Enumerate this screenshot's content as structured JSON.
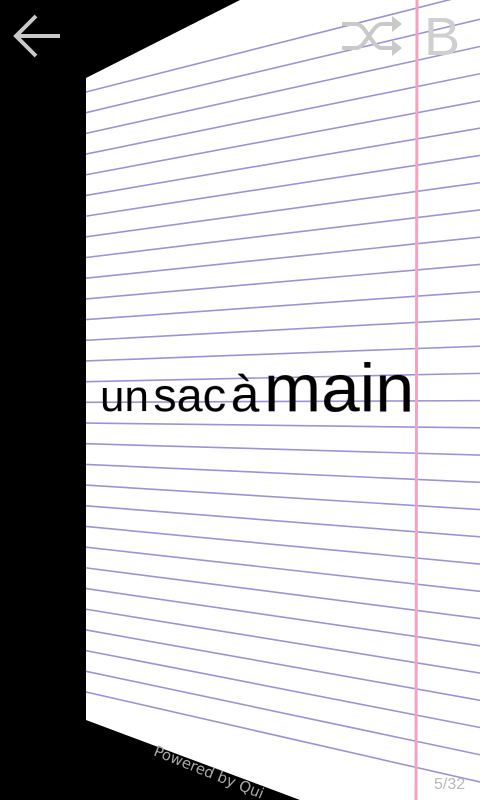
{
  "card": {
    "term_words": [
      "un",
      "sac",
      "à",
      "main"
    ],
    "powered_by": "Powered by Qui",
    "counter": "5/32"
  },
  "toolbar": {
    "back_icon": "arrow-left-icon",
    "shuffle_icon": "shuffle-icon",
    "bold_label": "B"
  },
  "colors": {
    "paper": "#ffffff",
    "rule_line": "#9a94d6",
    "margin_line": "#f3a3c0",
    "toolbar_icon": "#c9c9c9"
  }
}
